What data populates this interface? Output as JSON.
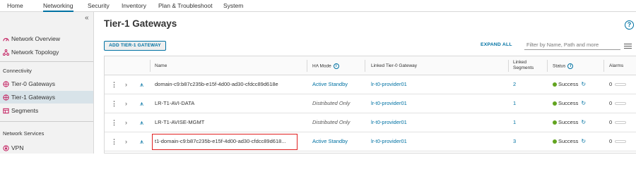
{
  "topnav": {
    "tabs": [
      "Home",
      "Networking",
      "Security",
      "Inventory",
      "Plan & Troubleshoot",
      "System"
    ],
    "active": "Networking"
  },
  "sidebar": {
    "collapse_icon": "«",
    "items": [
      {
        "label": "Network Overview",
        "icon": "network-overview-icon"
      },
      {
        "label": "Network Topology",
        "icon": "topology-icon"
      }
    ],
    "sections": [
      {
        "title": "Connectivity",
        "items": [
          {
            "label": "Tier-0 Gateways",
            "icon": "tier0-gateway-icon"
          },
          {
            "label": "Tier-1 Gateways",
            "icon": "tier1-gateway-icon",
            "active": true
          },
          {
            "label": "Segments",
            "icon": "segments-icon"
          }
        ]
      },
      {
        "title": "Network Services",
        "items": [
          {
            "label": "VPN",
            "icon": "vpn-icon"
          }
        ]
      }
    ]
  },
  "main": {
    "title": "Tier-1 Gateways",
    "help": "?",
    "add_button": "ADD TIER-1 GATEWAY",
    "expand_all": "EXPAND ALL",
    "filter_placeholder": "Filter by Name, Path and more"
  },
  "table": {
    "headers": {
      "name": "Name",
      "ha_mode": "HA Mode",
      "linked_t0": "Linked Tier-0 Gateway",
      "linked_segments_1": "Linked",
      "linked_segments_2": "Segments",
      "status": "Status",
      "alarms": "Alarms"
    },
    "rows": [
      {
        "name": "domain-c9:b87c235b-e15f-4d00-ad30-cfdcc89d618e",
        "ha_mode": "Active Standby",
        "ha_link": true,
        "linked_t0": "lr-t0-provider01",
        "linked_segments": "2",
        "status": "Success",
        "alarms": "0",
        "highlighted": false
      },
      {
        "name": "LR-T1-AVI-DATA",
        "ha_mode": "Distributed Only",
        "ha_link": false,
        "linked_t0": "lr-t0-provider01",
        "linked_segments": "1",
        "status": "Success",
        "alarms": "0",
        "highlighted": false
      },
      {
        "name": "LR-T1-AVISE-MGMT",
        "ha_mode": "Distributed Only",
        "ha_link": false,
        "linked_t0": "lr-t0-provider01",
        "linked_segments": "1",
        "status": "Success",
        "alarms": "0",
        "highlighted": false
      },
      {
        "name": "t1-domain-c9:b87c235b-e15f-4d00-ad30-cfdcc89d618...",
        "ha_mode": "Active Standby",
        "ha_link": true,
        "linked_t0": "lr-t0-provider01",
        "linked_segments": "3",
        "status": "Success",
        "alarms": "0",
        "highlighted": true
      }
    ]
  },
  "colors": {
    "accent": "#0072a3",
    "success": "#62a420",
    "highlight": "#e02020",
    "sidebar_active": "#d8e3e9"
  }
}
